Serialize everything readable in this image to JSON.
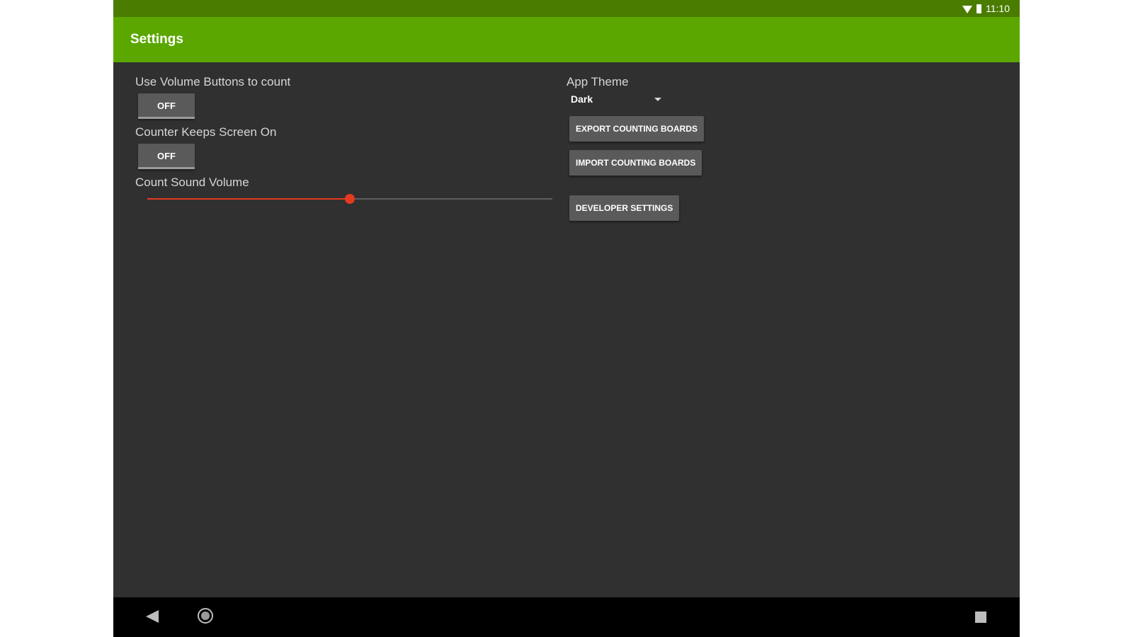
{
  "status_bar": {
    "time": "11:10",
    "icons": [
      "wifi-icon",
      "battery-icon"
    ]
  },
  "app_bar": {
    "title": "Settings"
  },
  "settings": {
    "volume_buttons": {
      "label": "Use Volume Buttons to count",
      "toggle_label": "OFF"
    },
    "keep_screen_on": {
      "label": "Counter Keeps Screen On",
      "toggle_label": "OFF"
    },
    "sound_volume": {
      "label": "Count Sound Volume",
      "value_fraction": 0.5
    },
    "app_theme": {
      "label": "App Theme",
      "selected": "Dark"
    },
    "buttons": {
      "export": "EXPORT COUNTING BOARDS",
      "import": "IMPORT COUNTING BOARDS",
      "developer": "DEVELOPER SETTINGS"
    }
  },
  "nav_bar": {
    "icons": [
      "back-icon",
      "home-icon",
      "recents-icon"
    ]
  },
  "colors": {
    "status_bar": "#4a7c00",
    "app_bar": "#5ba700",
    "background": "#303030",
    "slider_accent": "#e53a1f",
    "button": "#5a5a5a"
  }
}
